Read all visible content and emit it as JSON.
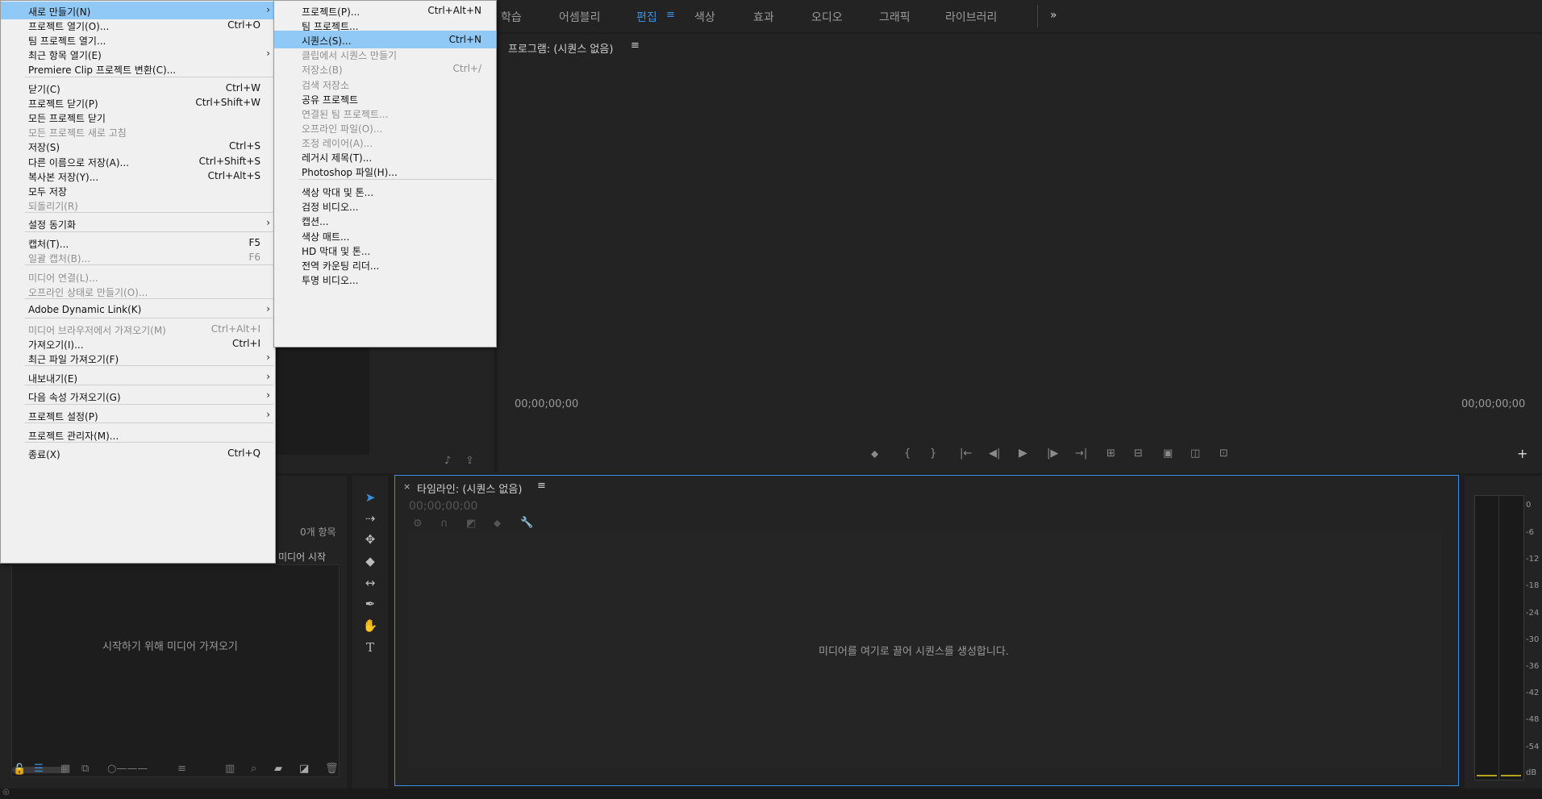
{
  "workspaces": [
    "학습",
    "어셈블리",
    "편집",
    "색상",
    "효과",
    "오디오",
    "그래픽",
    "라이브러리"
  ],
  "workspace_menu_icon": "hamburger-icon",
  "overflow_icon": "double-chevron-right-icon",
  "program": {
    "title": "프로그램: (시퀀스 없음)",
    "tc_left": "00;00;00;00",
    "tc_right": "00;00;00;00"
  },
  "timeline": {
    "title": "타임라인: (시퀀스 없음)",
    "timecode": "00;00;00;00",
    "drop_text": "미디어를 여기로 끌어 시퀀스를 생성합니다."
  },
  "project": {
    "count": "0개 항목",
    "column": "미디어 시작",
    "import_hint": "시작하기 위해 미디어 가져오기"
  },
  "meter": {
    "labels": [
      "0",
      "-6",
      "-12",
      "-18",
      "-24",
      "-30",
      "-36",
      "-42",
      "-48",
      "-54",
      "dB"
    ]
  },
  "file_menu": [
    {
      "label": "새로 만들기(N)",
      "shortcut": "",
      "submenu": true,
      "highlight": true
    },
    {
      "label": "프로젝트 열기(O)...",
      "shortcut": "Ctrl+O"
    },
    {
      "label": "팀 프로젝트 열기...",
      "shortcut": ""
    },
    {
      "label": "최근 항목 열기(E)",
      "shortcut": "",
      "submenu": true
    },
    {
      "label": "Premiere Clip 프로젝트 변환(C)...",
      "shortcut": ""
    },
    {
      "sep": true
    },
    {
      "label": "닫기(C)",
      "shortcut": "Ctrl+W"
    },
    {
      "label": "프로젝트 닫기(P)",
      "shortcut": "Ctrl+Shift+W"
    },
    {
      "label": "모든 프로젝트 닫기",
      "shortcut": ""
    },
    {
      "label": "모든 프로젝트 새로 고침",
      "shortcut": "",
      "disabled": true
    },
    {
      "label": "저장(S)",
      "shortcut": "Ctrl+S"
    },
    {
      "label": "다른 이름으로 저장(A)...",
      "shortcut": "Ctrl+Shift+S"
    },
    {
      "label": "복사본 저장(Y)...",
      "shortcut": "Ctrl+Alt+S"
    },
    {
      "label": "모두 저장",
      "shortcut": ""
    },
    {
      "label": "되돌리기(R)",
      "shortcut": "",
      "disabled": true
    },
    {
      "sep": true
    },
    {
      "label": "설정 동기화",
      "shortcut": "",
      "submenu": true
    },
    {
      "sep": true
    },
    {
      "label": "캡처(T)...",
      "shortcut": "F5"
    },
    {
      "label": "일괄 캡처(B)...",
      "shortcut": "F6",
      "disabled": true
    },
    {
      "sep": true
    },
    {
      "label": "미디어 연결(L)...",
      "shortcut": "",
      "disabled": true
    },
    {
      "label": "오프라인 상태로 만들기(O)...",
      "shortcut": "",
      "disabled": true
    },
    {
      "sep": true
    },
    {
      "label": "Adobe Dynamic Link(K)",
      "shortcut": "",
      "submenu": true
    },
    {
      "sep": true
    },
    {
      "label": "미디어 브라우저에서 가져오기(M)",
      "shortcut": "Ctrl+Alt+I",
      "disabled": true
    },
    {
      "label": "가져오기(I)...",
      "shortcut": "Ctrl+I"
    },
    {
      "label": "최근 파일 가져오기(F)",
      "shortcut": "",
      "submenu": true
    },
    {
      "sep": true
    },
    {
      "label": "내보내기(E)",
      "shortcut": "",
      "submenu": true
    },
    {
      "sep": true
    },
    {
      "label": "다음 속성 가져오기(G)",
      "shortcut": "",
      "submenu": true
    },
    {
      "sep": true
    },
    {
      "label": "프로젝트 설정(P)",
      "shortcut": "",
      "submenu": true
    },
    {
      "sep": true
    },
    {
      "label": "프로젝트 관리자(M)...",
      "shortcut": ""
    },
    {
      "sep": true
    },
    {
      "label": "종료(X)",
      "shortcut": "Ctrl+Q"
    }
  ],
  "new_submenu": [
    {
      "label": "프로젝트(P)...",
      "shortcut": "Ctrl+Alt+N"
    },
    {
      "label": "팀 프로젝트...",
      "shortcut": ""
    },
    {
      "label": "시퀀스(S)...",
      "shortcut": "Ctrl+N",
      "highlight": true
    },
    {
      "label": "클립에서 시퀀스 만들기",
      "shortcut": "",
      "disabled": true
    },
    {
      "label": "저장소(B)",
      "shortcut": "Ctrl+/",
      "disabled": true
    },
    {
      "label": "검색 저장소",
      "shortcut": "",
      "disabled": true
    },
    {
      "label": "공유 프로젝트",
      "shortcut": ""
    },
    {
      "label": "연결된 팀 프로젝트...",
      "shortcut": "",
      "disabled": true
    },
    {
      "label": "오프라인 파일(O)...",
      "shortcut": "",
      "disabled": true
    },
    {
      "label": "조정 레이어(A)...",
      "shortcut": "",
      "disabled": true
    },
    {
      "label": "레거시 제목(T)...",
      "shortcut": ""
    },
    {
      "label": "Photoshop 파일(H)...",
      "shortcut": ""
    },
    {
      "sep": true
    },
    {
      "label": "색상 막대 및 톤...",
      "shortcut": ""
    },
    {
      "label": "검정 비디오...",
      "shortcut": ""
    },
    {
      "label": "캡션...",
      "shortcut": ""
    },
    {
      "label": "색상 매트...",
      "shortcut": ""
    },
    {
      "label": "HD 막대 및 톤...",
      "shortcut": ""
    },
    {
      "label": "전역 카운팅 리더...",
      "shortcut": ""
    },
    {
      "label": "투명 비디오...",
      "shortcut": ""
    }
  ],
  "colors": {
    "accent": "#3b8fe0",
    "menu_bg": "#f0f0f0",
    "menu_highlight": "#90c8f6",
    "panel_bg": "#232323"
  }
}
